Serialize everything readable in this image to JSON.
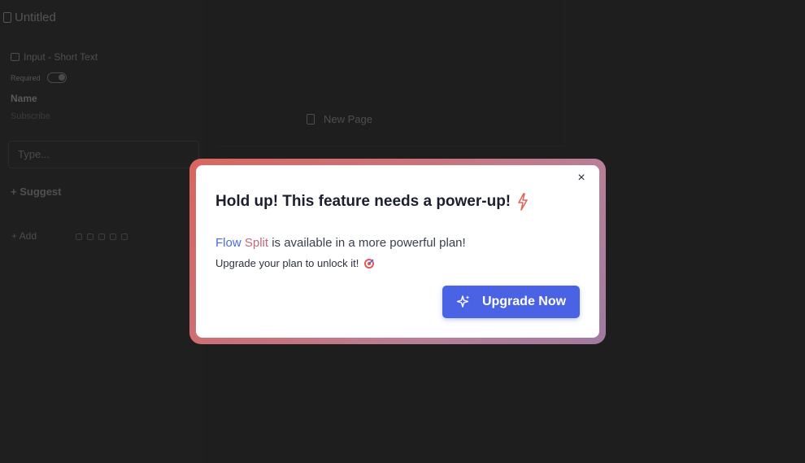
{
  "background": {
    "doc_title": "Untitled",
    "field_type": "Input - Short Text",
    "required_label": "Required",
    "field_name": "Name",
    "field_subtitle": "Subscribe",
    "type_placeholder": "Type...",
    "suggest_label": "+ Suggest",
    "add_label": "+ Add",
    "page_node_label": "New Page"
  },
  "modal": {
    "title": "Hold up! This feature needs a power-up!",
    "feature_name_part1": "Flow",
    "feature_name_part2": "Split",
    "feature_suffix": "is available in a more powerful plan!",
    "unlock_text": "Upgrade your plan to unlock it!",
    "upgrade_label": "Upgrade Now",
    "close_icon": "×"
  },
  "colors": {
    "accent": "#4a63e5",
    "frame_gradient_start": "#d9665f",
    "frame_gradient_end": "#a07aa0",
    "bolt": "#e0665a"
  }
}
